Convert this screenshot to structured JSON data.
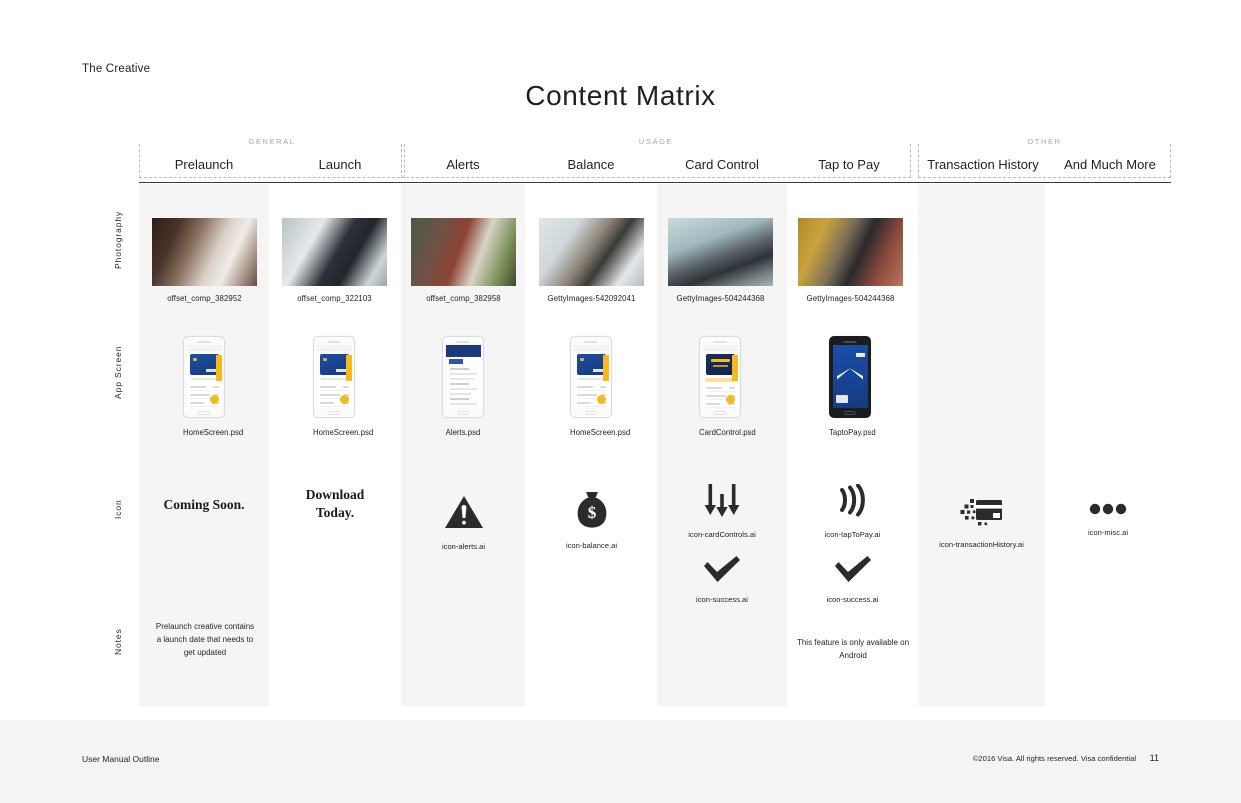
{
  "header": {
    "brand": "The Creative",
    "title": "Content Matrix"
  },
  "groups": [
    {
      "label": "GENERAL"
    },
    {
      "label": "USAGE"
    },
    {
      "label": "OTHER"
    }
  ],
  "columns": [
    {
      "label": "Prelaunch"
    },
    {
      "label": "Launch"
    },
    {
      "label": "Alerts"
    },
    {
      "label": "Balance"
    },
    {
      "label": "Card Control"
    },
    {
      "label": "Tap to Pay"
    },
    {
      "label": "Transaction History"
    },
    {
      "label": "And Much More"
    }
  ],
  "rows": [
    {
      "label": "Photography"
    },
    {
      "label": "App Screen"
    },
    {
      "label": "Icon"
    },
    {
      "label": "Notes"
    }
  ],
  "photography": [
    {
      "caption": "offset_comp_382952"
    },
    {
      "caption": "offset_comp_322103"
    },
    {
      "caption": "offset_comp_382958"
    },
    {
      "caption": "GettyImages-542092041"
    },
    {
      "caption": "GettyImages-504244368"
    },
    {
      "caption": "GettyImages-504244368"
    },
    {
      "caption": ""
    },
    {
      "caption": ""
    }
  ],
  "app_screens": [
    {
      "caption": "HomeScreen.psd"
    },
    {
      "caption": "HomeScreen.psd"
    },
    {
      "caption": "Alerts.psd"
    },
    {
      "caption": "HomeScreen.psd"
    },
    {
      "caption": "CardControl.psd"
    },
    {
      "caption": "TaptoPay.psd"
    },
    {
      "caption": ""
    },
    {
      "caption": ""
    }
  ],
  "icons": [
    {
      "text": "Coming Soon.",
      "icon": "",
      "caption": ""
    },
    {
      "text": "Download\nToday.",
      "icon": "",
      "caption": ""
    },
    {
      "text": "",
      "icon": "alert-triangle-icon",
      "caption": "icon-alerts.ai"
    },
    {
      "text": "",
      "icon": "money-bag-icon",
      "caption": "icon-balance.ai"
    },
    {
      "text": "",
      "icon": "sliders-icon",
      "caption": "icon-cardControls.ai",
      "icon2": "check-icon",
      "caption2": "icon-success.ai"
    },
    {
      "text": "",
      "icon": "contactless-pay-icon",
      "caption": "icon-tapToPay.ai",
      "icon2": "check-icon",
      "caption2": "icon-success.ai"
    },
    {
      "text": "",
      "icon": "credit-card-pixel-icon",
      "caption": "icon-transactionHistory.ai"
    },
    {
      "text": "",
      "icon": "ellipsis-icon",
      "caption": "icon-misc.ai"
    }
  ],
  "notes": [
    "Prelaunch creative contains a launch date that needs to get updated",
    "",
    "",
    "",
    "",
    "This feature is only available on Android",
    "",
    ""
  ],
  "footer": {
    "left": "User Manual Outline",
    "copyright": "©2016 Visa. All rights reserved. Visa confidential",
    "page": "11"
  },
  "colors": {
    "stripe": "#f5f5f5",
    "rule": "#3a3a3a",
    "group_border": "#b9b9b9",
    "ink": "#231f20",
    "visa_blue": "#1a4ea8",
    "visa_gold": "#f6b91e"
  }
}
